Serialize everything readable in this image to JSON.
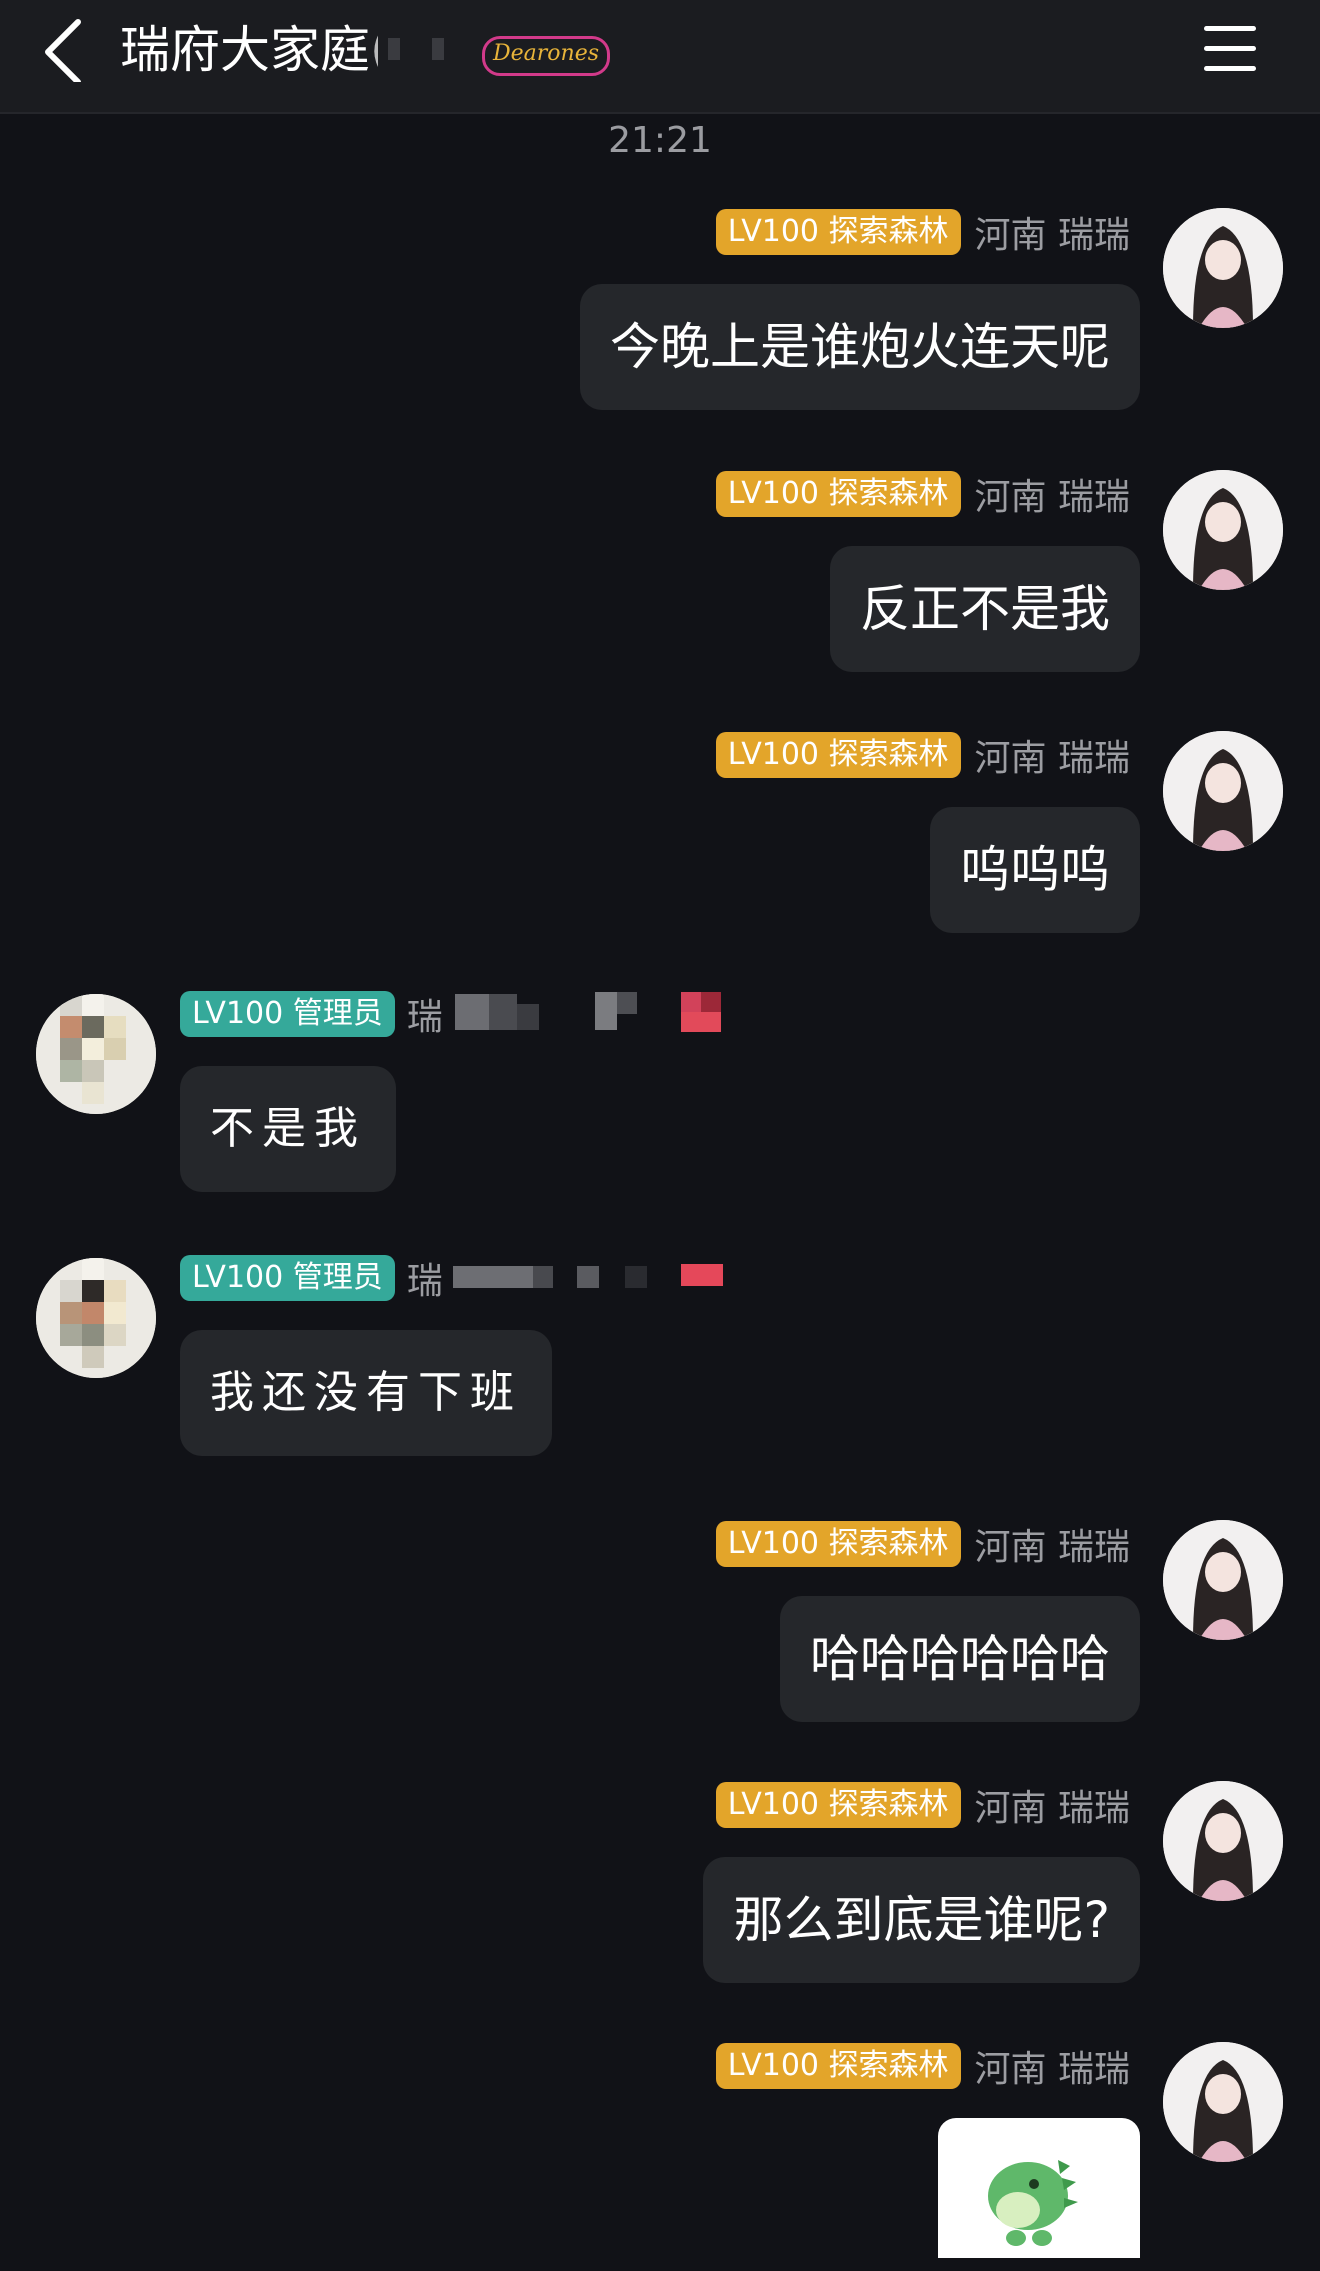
{
  "header": {
    "title": "瑞府大家庭",
    "title_suffix_fragment": "(",
    "logo_text": "Dearones",
    "back_icon": "chevron-left-icon",
    "menu_icon": "hamburger-menu-icon"
  },
  "timestamp": "21:21",
  "colors": {
    "background": "#111217",
    "bubble": "#25272b",
    "badge_gold": "#e3a52a",
    "badge_teal": "#35a99a",
    "meta_text": "#9c9da2"
  },
  "messages": [
    {
      "side": "right",
      "badge": "LV100 探索森林",
      "sender": "河南 瑞瑞",
      "text": "今晚上是谁炮火连天呢"
    },
    {
      "side": "right",
      "badge": "LV100 探索森林",
      "sender": "河南 瑞瑞",
      "text": "反正不是我"
    },
    {
      "side": "right",
      "badge": "LV100 探索森林",
      "sender": "河南 瑞瑞",
      "text": "呜呜呜"
    },
    {
      "side": "left",
      "badge": "LV100 管理员",
      "sender": "瑞",
      "text": "不是我"
    },
    {
      "side": "left",
      "badge": "LV100 管理员",
      "sender": "瑞",
      "text": "我还没有下班"
    },
    {
      "side": "right",
      "badge": "LV100 探索森林",
      "sender": "河南 瑞瑞",
      "text": "哈哈哈哈哈哈"
    },
    {
      "side": "right",
      "badge": "LV100 探索森林",
      "sender": "河南 瑞瑞",
      "text": "那么到底是谁呢?"
    },
    {
      "side": "right",
      "badge": "LV100 探索森林",
      "sender": "河南 瑞瑞",
      "sticker": "green-dinosaur-sticker"
    }
  ]
}
